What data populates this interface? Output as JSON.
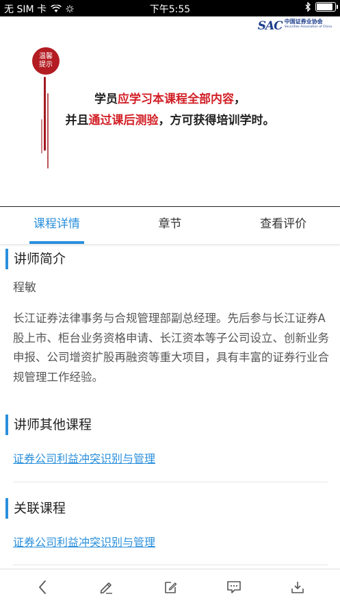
{
  "status_bar": {
    "carrier": "无 SIM 卡",
    "time": "下午5:55",
    "battery_level": 0.9
  },
  "banner": {
    "logo_mark": "SAC",
    "logo_cn": "中国证券业协会",
    "logo_en": "Securities Association of China",
    "seal_line1": "温馨",
    "seal_line2": "提示",
    "line1_a": "学员",
    "line1_hl": "应学习本课程全部内容",
    "line1_b": "，",
    "line2_a": "并且",
    "line2_hl": "通过课后测验",
    "line2_b": "，方可获得培训学时。"
  },
  "tabs": {
    "details": "课程详情",
    "chapters": "章节",
    "reviews": "查看评价"
  },
  "sections": {
    "teacher_intro_title": "讲师简介",
    "teacher_name": "程敏",
    "teacher_bio": "长江证券法律事务与合规管理部副总经理。先后参与长江证券A股上市、柜台业务资格申请、长江资本等子公司设立、创新业务申报、公司增资扩股再融资等重大项目，具有丰富的证券行业合规管理工作经验。",
    "other_courses_title": "讲师其他课程",
    "other_course_link": "证券公司利益冲突识别与管理",
    "related_title": "关联课程",
    "related_link": "证券公司利益冲突识别与管理"
  },
  "colors": {
    "accent": "#2a8fdc",
    "highlight": "#d21f26",
    "seal": "#b31c22"
  },
  "toolbar_icons": [
    "back-icon",
    "pen-icon",
    "edit-note-icon",
    "comment-icon",
    "download-icon"
  ]
}
